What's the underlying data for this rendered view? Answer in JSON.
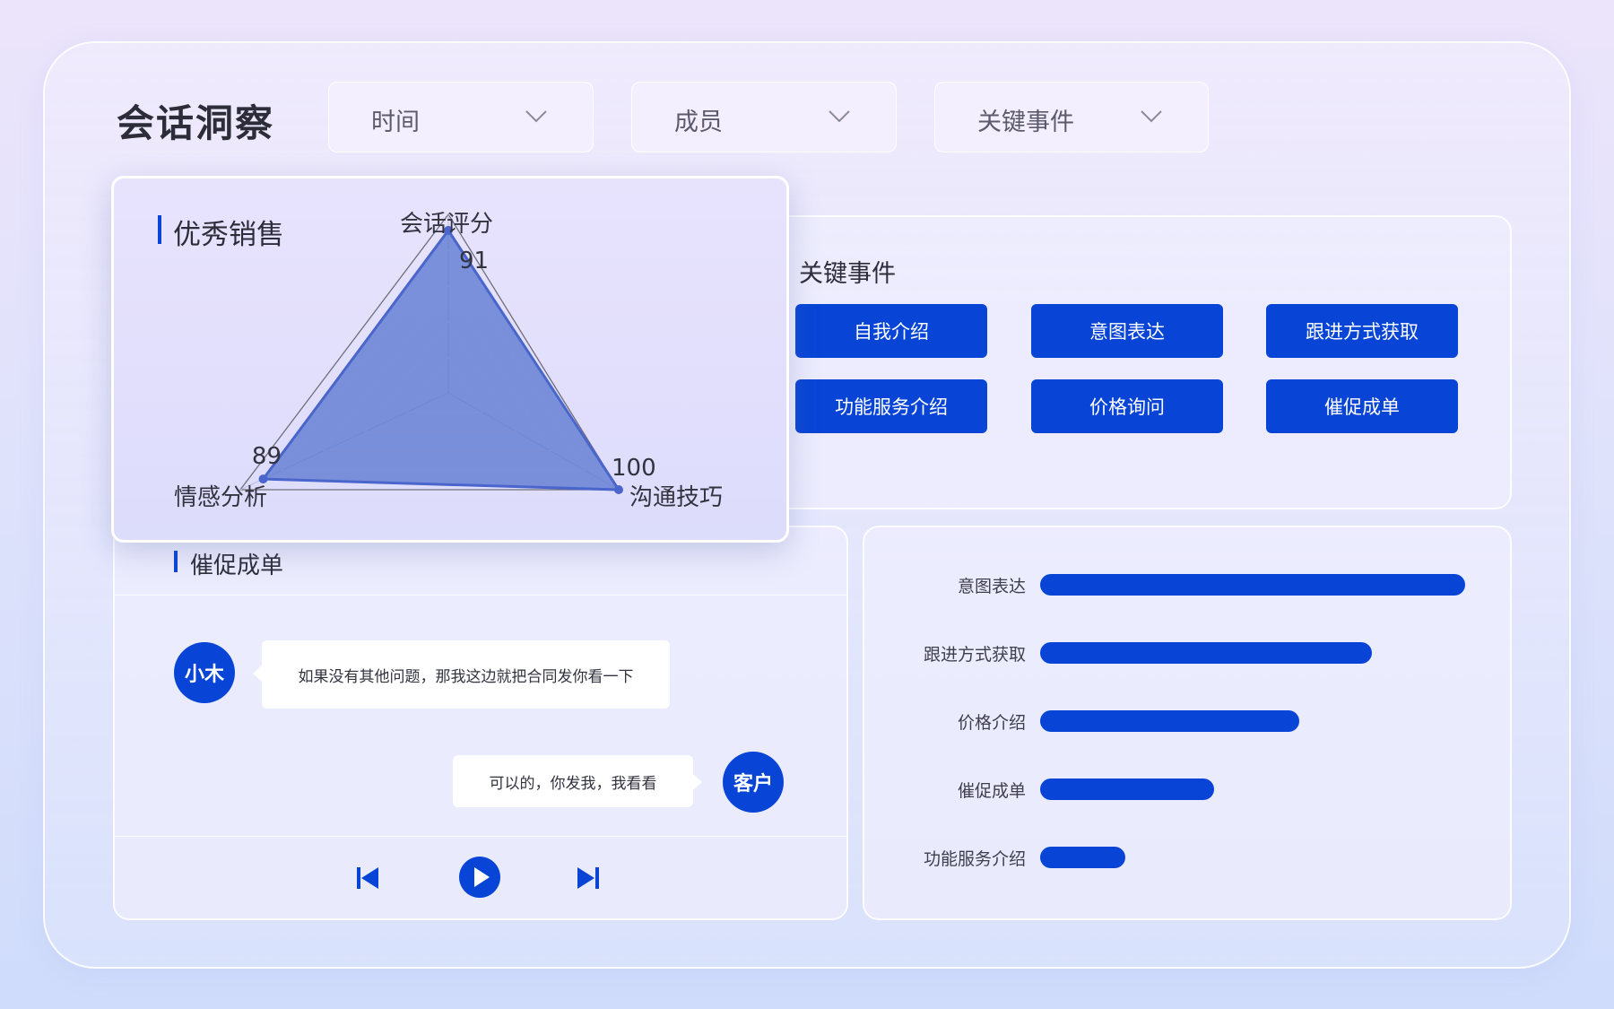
{
  "header": {
    "title": "会话洞察",
    "filters": [
      {
        "label": "时间"
      },
      {
        "label": "成员"
      },
      {
        "label": "关键事件"
      }
    ]
  },
  "radar": {
    "title": "优秀销售",
    "axes": [
      {
        "label": "会话评分",
        "value": 91,
        "value_label": "91"
      },
      {
        "label": "沟通技巧",
        "value": 100,
        "value_label": "100"
      },
      {
        "label": "情感分析",
        "value": 89,
        "value_label": "89"
      }
    ],
    "max": 100,
    "fill_color": "#5c78d0",
    "line_color": "#4a66cc"
  },
  "key_events": {
    "title": "关键事件",
    "buttons": [
      "自我介绍",
      "意图表达",
      "跟进方式获取",
      "功能服务介绍",
      "价格询问",
      "催促成单"
    ]
  },
  "chat": {
    "title": "催促成单",
    "messages": [
      {
        "speaker": "小木",
        "text": "如果没有其他问题，那我这边就把合同发你看一下"
      },
      {
        "speaker": "客户",
        "text": "可以的，你发我，我看看"
      }
    ],
    "controls": [
      "previous-track-icon",
      "play-icon",
      "next-track-icon"
    ]
  },
  "bars": {
    "items": [
      {
        "label": "意图表达",
        "value": 100
      },
      {
        "label": "跟进方式获取",
        "value": 78
      },
      {
        "label": "价格介绍",
        "value": 61
      },
      {
        "label": "催促成单",
        "value": 41
      },
      {
        "label": "功能服务介绍",
        "value": 20
      }
    ],
    "max": 100,
    "color": "#0845d6"
  },
  "colors": {
    "accent": "#0845d6",
    "title_text": "#2d2d3a"
  }
}
